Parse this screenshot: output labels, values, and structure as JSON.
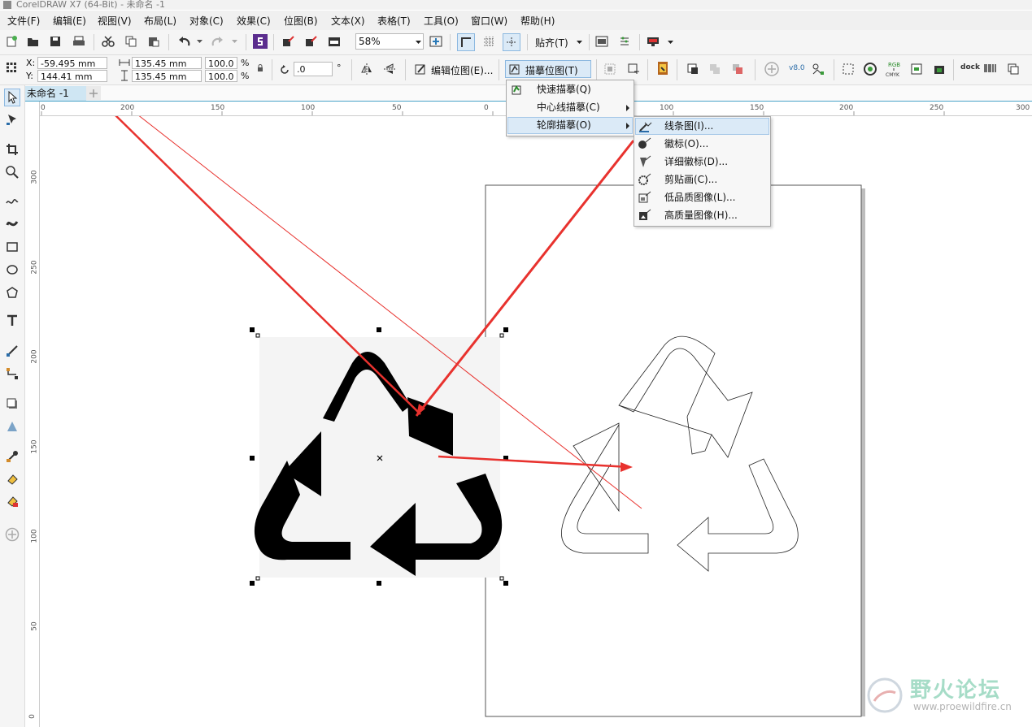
{
  "window": {
    "title": "CorelDRAW X7 (64-Bit) - 未命名 -1"
  },
  "menubar": [
    "文件(F)",
    "编辑(E)",
    "视图(V)",
    "布局(L)",
    "对象(C)",
    "效果(C)",
    "位图(B)",
    "文本(X)",
    "表格(T)",
    "工具(O)",
    "窗口(W)",
    "帮助(H)"
  ],
  "toolbar": {
    "zoom": "58%",
    "snap_label": "贴齐(T)"
  },
  "property_bar": {
    "x_label": "X:",
    "x_value": "-59.495 mm",
    "y_label": "Y:",
    "y_value": "144.41 mm",
    "width_value": "135.45 mm",
    "height_value": "135.45 mm",
    "scale_w": "100.0",
    "scale_h": "100.0",
    "percent": "%",
    "angle_value": ".0",
    "degree": "°",
    "edit_bitmap": "编辑位图(E)...",
    "trace_bitmap": "描摹位图(T)",
    "v80": "v8.0",
    "rgb": "RGB",
    "cmyk": "CMYK",
    "dock": "dock"
  },
  "document_tab": "未命名 -1",
  "ruler": {
    "h_labels": [
      "0",
      "200",
      "150",
      "100",
      "50",
      "0",
      "50",
      "100",
      "150",
      "200",
      "250",
      "300"
    ],
    "v_labels": [
      "300",
      "250",
      "200",
      "150",
      "100",
      "50",
      "0"
    ]
  },
  "trace_menu": {
    "items": [
      {
        "label": "快速描摹(Q)",
        "has_submenu": false
      },
      {
        "label": "中心线描摹(C)",
        "has_submenu": true
      },
      {
        "label": "轮廓描摹(O)",
        "has_submenu": true,
        "highlighted": true
      }
    ]
  },
  "outline_submenu": {
    "items": [
      {
        "label": "线条图(I)...",
        "highlighted": true
      },
      {
        "label": "徽标(O)..."
      },
      {
        "label": "详细徽标(D)..."
      },
      {
        "label": "剪贴画(C)..."
      },
      {
        "label": "低品质图像(L)..."
      },
      {
        "label": "高质量图像(H)..."
      }
    ]
  },
  "watermark": {
    "name": "野火论坛",
    "url": "www.proewildfire.cn"
  },
  "colors": {
    "accent": "#4aa3c8",
    "arrow": "#e8322e",
    "highlight": "#dbeaf7"
  }
}
